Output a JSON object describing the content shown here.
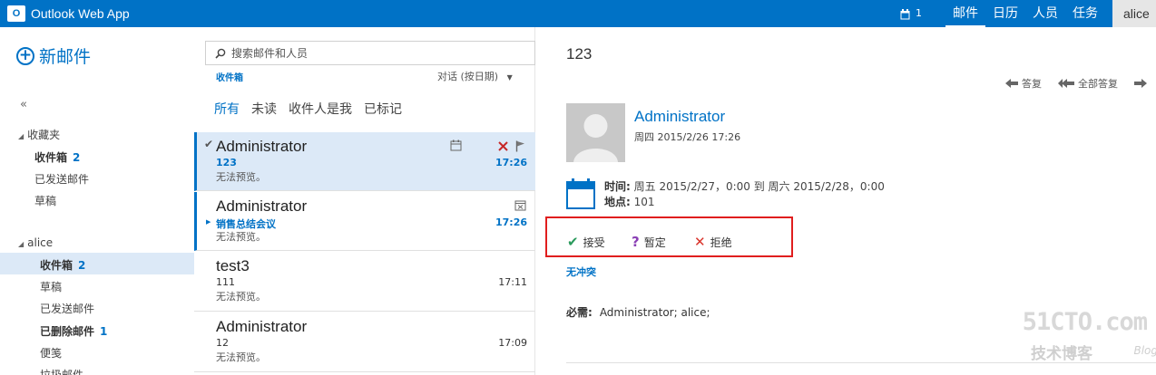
{
  "app": {
    "title": "Outlook Web App",
    "logo_letter": "O"
  },
  "topnav": {
    "notif_count": "1",
    "items": [
      "邮件",
      "日历",
      "人员",
      "任务"
    ],
    "user": "alice"
  },
  "sidebar": {
    "new_mail": "新邮件",
    "collapse": "«",
    "favorites": {
      "title": "收藏夹",
      "items": [
        {
          "label": "收件箱",
          "count": "2"
        },
        {
          "label": "已发送邮件"
        },
        {
          "label": "草稿"
        }
      ]
    },
    "account": {
      "title": "alice",
      "items": [
        {
          "label": "收件箱",
          "count": "2"
        },
        {
          "label": "草稿"
        },
        {
          "label": "已发送邮件"
        },
        {
          "label": "已删除邮件",
          "count": "1"
        },
        {
          "label": "便笺"
        },
        {
          "label": "垃圾邮件"
        }
      ]
    }
  },
  "list": {
    "search_placeholder": "搜索邮件和人员",
    "folder": "收件箱",
    "sort": "对话 (按日期)",
    "filters": [
      "所有",
      "未读",
      "收件人是我",
      "已标记"
    ],
    "messages": [
      {
        "sender": "Administrator",
        "subject": "123",
        "preview": "无法预览。",
        "time": "17:26"
      },
      {
        "sender": "Administrator",
        "subject": "销售总结会议",
        "preview": "无法预览。",
        "time": "17:26"
      },
      {
        "sender": "test3",
        "subject": "111",
        "preview": "无法预览。",
        "time": "17:11"
      },
      {
        "sender": "Administrator",
        "subject": "12",
        "preview": "无法预览。",
        "time": "17:09"
      }
    ]
  },
  "reading": {
    "title": "123",
    "actions": [
      "答复",
      "全部答复"
    ],
    "from_name": "Administrator",
    "from_date": "周四 2015/2/26 17:26",
    "time_label": "时间:",
    "time_value": "周五 2015/2/27，0:00 到 周六 2015/2/28，0:00",
    "location_label": "地点:",
    "location_value": "101",
    "responses": [
      "接受",
      "暂定",
      "拒绝"
    ],
    "no_conflict": "无冲突",
    "required_label": "必需:",
    "required_value": "Administrator;  alice;"
  },
  "watermark": {
    "main": "51CTO.com",
    "sub": "技术博客",
    "blog": "Blog"
  },
  "colors": {
    "accent": "#0072c6",
    "selected": "#dce9f7",
    "decline": "#d9342b",
    "accept": "#2a9a5c",
    "tentative": "#8a3fb5",
    "highlight_box": "#e01e1e"
  }
}
